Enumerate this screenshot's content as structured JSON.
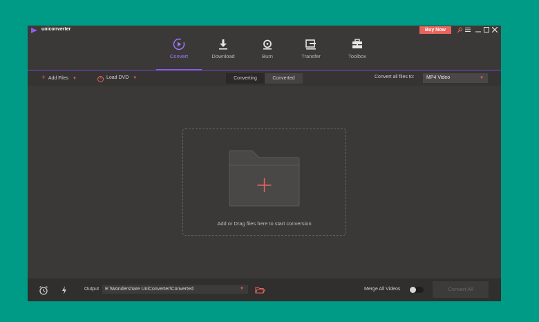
{
  "app": {
    "name": "uniconverter"
  },
  "titlebar": {
    "buy_now": "Buy Now"
  },
  "nav": [
    {
      "label": "Convert",
      "icon": "convert-icon",
      "active": true
    },
    {
      "label": "Download",
      "icon": "download-icon"
    },
    {
      "label": "Burn",
      "icon": "burn-icon"
    },
    {
      "label": "Transfer",
      "icon": "transfer-icon"
    },
    {
      "label": "Toolbox",
      "icon": "toolbox-icon"
    }
  ],
  "toolbar": {
    "add_files": "Add Files",
    "load_dvd": "Load DVD",
    "tabs": [
      "Converting",
      "Converted"
    ],
    "active_tab": "Converting",
    "convert_all_label": "Convert all files to:",
    "format": "MP4 Video"
  },
  "dropzone": {
    "text": "Add or Drag files here to start conversion"
  },
  "bottom": {
    "output_label": "Output",
    "output_path": "E:\\Wondershare UniConverter\\Converted",
    "merge_label": "Merge All Videos",
    "merge_enabled": false,
    "convert_all_button": "Convert All"
  },
  "colors": {
    "accent": "#8e5cf0",
    "brand_red": "#e8655d",
    "background": "#3b3938"
  }
}
